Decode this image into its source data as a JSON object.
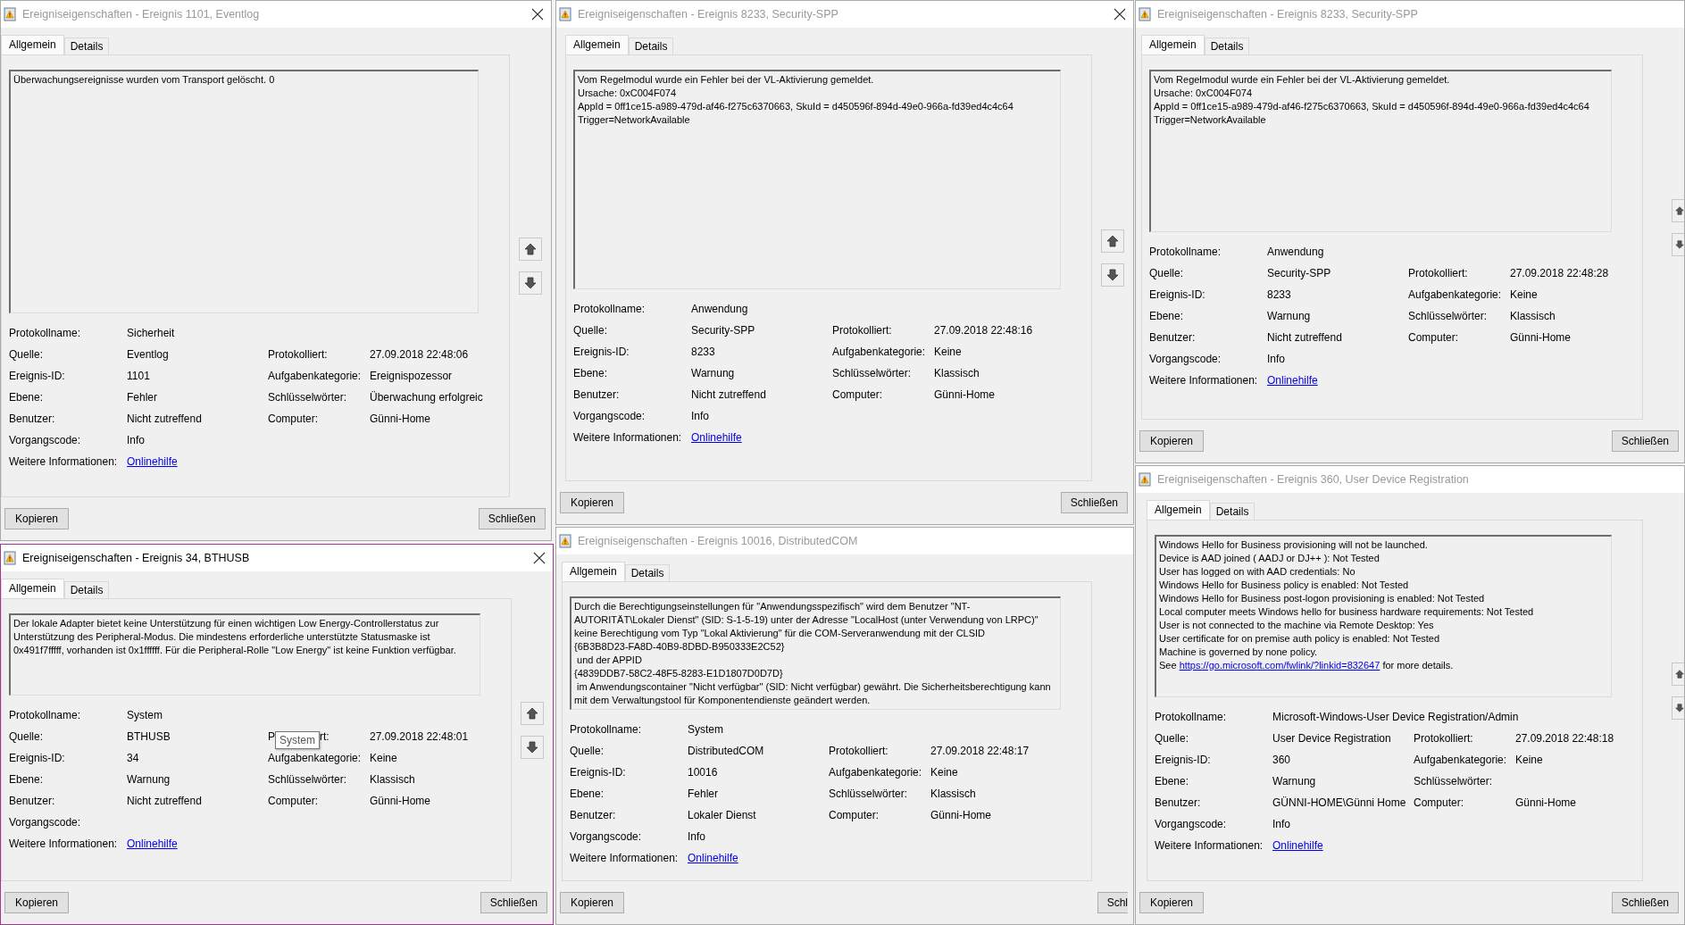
{
  "windows": [
    {
      "title": "Ereigniseigenschaften - Ereignis 1101, Eventlog",
      "active": false,
      "close_button": true,
      "nav_buttons": true,
      "tabs": [
        {
          "label": "Allgemein",
          "selected": true
        },
        {
          "label": "Details",
          "selected": false
        }
      ],
      "message": "Überwachungsereignisse wurden vom Transport gelöscht. 0",
      "fields": [
        {
          "cells": [
            {
              "label": "Protokollname:",
              "value": "Sicherheit"
            }
          ]
        },
        {
          "cells": [
            {
              "label": "Quelle:",
              "value": "Eventlog"
            },
            {
              "label": "Protokolliert:",
              "value": "27.09.2018 22:48:06"
            }
          ]
        },
        {
          "cells": [
            {
              "label": "Ereignis-ID:",
              "value": "1101"
            },
            {
              "label": "Aufgabenkategorie:",
              "value": "Ereignispozessor"
            }
          ]
        },
        {
          "cells": [
            {
              "label": "Ebene:",
              "value": "Fehler"
            },
            {
              "label": "Schlüsselwörter:",
              "value": "Überwachung erfolgreic"
            }
          ]
        },
        {
          "cells": [
            {
              "label": "Benutzer:",
              "value": "Nicht zutreffend"
            },
            {
              "label": "Computer:",
              "value": "Günni-Home"
            }
          ]
        },
        {
          "cells": [
            {
              "label": "Vorgangscode:",
              "value": "Info"
            }
          ]
        },
        {
          "cells": [
            {
              "label": "Weitere Informationen:",
              "link": "Onlinehilfe"
            }
          ]
        }
      ],
      "buttons": [
        "Kopieren",
        "Schließen"
      ]
    },
    {
      "title": "Ereigniseigenschaften - Ereignis 8233, Security-SPP",
      "active": false,
      "close_button": true,
      "nav_buttons": true,
      "tabs": [
        {
          "label": "Allgemein",
          "selected": true
        },
        {
          "label": "Details",
          "selected": false
        }
      ],
      "message": "Vom Regelmodul wurde ein Fehler bei der VL-Aktivierung gemeldet.\nUrsache: 0xC004F074\nAppId = 0ff1ce15-a989-479d-af46-f275c6370663, SkuId = d450596f-894d-49e0-966a-fd39ed4c4c64\nTrigger=NetworkAvailable",
      "fields": [
        {
          "cells": [
            {
              "label": "Protokollname:",
              "value": "Anwendung"
            }
          ]
        },
        {
          "cells": [
            {
              "label": "Quelle:",
              "value": "Security-SPP"
            },
            {
              "label": "Protokolliert:",
              "value": "27.09.2018 22:48:16"
            }
          ]
        },
        {
          "cells": [
            {
              "label": "Ereignis-ID:",
              "value": "8233"
            },
            {
              "label": "Aufgabenkategorie:",
              "value": "Keine"
            }
          ]
        },
        {
          "cells": [
            {
              "label": "Ebene:",
              "value": "Warnung"
            },
            {
              "label": "Schlüsselwörter:",
              "value": "Klassisch"
            }
          ]
        },
        {
          "cells": [
            {
              "label": "Benutzer:",
              "value": "Nicht zutreffend"
            },
            {
              "label": "Computer:",
              "value": "Günni-Home"
            }
          ]
        },
        {
          "cells": [
            {
              "label": "Vorgangscode:",
              "value": "Info"
            }
          ]
        },
        {
          "cells": [
            {
              "label": "Weitere Informationen:",
              "link": "Onlinehilfe"
            }
          ]
        }
      ],
      "buttons": [
        "Kopieren",
        "Schließen"
      ]
    },
    {
      "title": "Ereigniseigenschaften - Ereignis 8233, Security-SPP",
      "active": false,
      "close_button": false,
      "nav_buttons": true,
      "tabs": [
        {
          "label": "Allgemein",
          "selected": true
        },
        {
          "label": "Details",
          "selected": false
        }
      ],
      "message": "Vom Regelmodul wurde ein Fehler bei der VL-Aktivierung gemeldet.\nUrsache: 0xC004F074\nAppId = 0ff1ce15-a989-479d-af46-f275c6370663, SkuId = d450596f-894d-49e0-966a-fd39ed4c4c64\nTrigger=NetworkAvailable",
      "fields": [
        {
          "cells": [
            {
              "label": "Protokollname:",
              "value": "Anwendung"
            }
          ]
        },
        {
          "cells": [
            {
              "label": "Quelle:",
              "value": "Security-SPP"
            },
            {
              "label": "Protokolliert:",
              "value": "27.09.2018 22:48:28"
            }
          ]
        },
        {
          "cells": [
            {
              "label": "Ereignis-ID:",
              "value": "8233"
            },
            {
              "label": "Aufgabenkategorie:",
              "value": "Keine"
            }
          ]
        },
        {
          "cells": [
            {
              "label": "Ebene:",
              "value": "Warnung"
            },
            {
              "label": "Schlüsselwörter:",
              "value": "Klassisch"
            }
          ]
        },
        {
          "cells": [
            {
              "label": "Benutzer:",
              "value": "Nicht zutreffend"
            },
            {
              "label": "Computer:",
              "value": "Günni-Home"
            }
          ]
        },
        {
          "cells": [
            {
              "label": "Vorgangscode:",
              "value": "Info"
            }
          ]
        },
        {
          "cells": [
            {
              "label": "Weitere Informationen:",
              "link": "Onlinehilfe"
            }
          ]
        }
      ],
      "buttons": [
        "Kopieren",
        "Schließen"
      ]
    },
    {
      "title": "Ereigniseigenschaften - Ereignis 34, BTHUSB",
      "active": true,
      "close_button": true,
      "nav_buttons": true,
      "tabs": [
        {
          "label": "Allgemein",
          "selected": true
        },
        {
          "label": "Details",
          "selected": false
        }
      ],
      "message": "Der lokale Adapter bietet keine Unterstützung für einen wichtigen Low Energy-Controllerstatus zur Unterstützung des Peripheral-Modus. Die mindestens erforderliche unterstützte Statusmaske ist 0x491f7fffff, vorhanden ist 0x1ffffff. Für die Peripheral-Rolle \"Low Energy\" ist keine Funktion verfügbar.",
      "fields": [
        {
          "cells": [
            {
              "label": "Protokollname:",
              "value": "System"
            }
          ]
        },
        {
          "cells": [
            {
              "label": "Quelle:",
              "value": "BTHUSB"
            },
            {
              "label": "P",
              "tooltip": "System",
              "label_end": "rt:",
              "value": "27.09.2018 22:48:01"
            }
          ]
        },
        {
          "cells": [
            {
              "label": "Ereignis-ID:",
              "value": "34"
            },
            {
              "label": "Aufgabenkategorie:",
              "value": "Keine"
            }
          ]
        },
        {
          "cells": [
            {
              "label": "Ebene:",
              "value": "Warnung"
            },
            {
              "label": "Schlüsselwörter:",
              "value": "Klassisch"
            }
          ]
        },
        {
          "cells": [
            {
              "label": "Benutzer:",
              "value": "Nicht zutreffend"
            },
            {
              "label": "Computer:",
              "value": "Günni-Home"
            }
          ]
        },
        {
          "cells": [
            {
              "label": "Vorgangscode:"
            }
          ]
        },
        {
          "cells": [
            {
              "label": "Weitere Informationen:",
              "link": "Onlinehilfe"
            }
          ]
        }
      ],
      "buttons": [
        "Kopieren",
        "Schließen"
      ]
    },
    {
      "title": "Ereigniseigenschaften - Ereignis 10016, DistributedCOM",
      "active": false,
      "close_button": false,
      "tabs": [
        {
          "label": "Allgemein",
          "selected": true
        },
        {
          "label": "Details",
          "selected": false
        }
      ],
      "message": "Durch die Berechtigungseinstellungen für \"Anwendungsspezifisch\" wird dem Benutzer \"NT-AUTORITÄT\\Lokaler Dienst\" (SID: S-1-5-19) unter der Adresse \"LocalHost (unter Verwendung von LRPC)\" keine Berechtigung vom Typ \"Lokal Aktivierung\" für die COM-Serveranwendung mit der CLSID\n{6B3B8D23-FA8D-40B9-8DBD-B950333E2C52}\n und der APPID\n{4839DDB7-58C2-48F5-8283-E1D1807D0D7D}\n im Anwendungscontainer \"Nicht verfügbar\" (SID: Nicht verfügbar) gewährt. Die Sicherheitsberechtigung kann mit dem Verwaltungstool für Komponentendienste geändert werden.",
      "fields": [
        {
          "cells": [
            {
              "label": "Protokollname:",
              "value": "System"
            }
          ]
        },
        {
          "cells": [
            {
              "label": "Quelle:",
              "value": "DistributedCOM"
            },
            {
              "label": "Protokolliert:",
              "value": "27.09.2018 22:48:17"
            }
          ]
        },
        {
          "cells": [
            {
              "label": "Ereignis-ID:",
              "value": "10016"
            },
            {
              "label": "Aufgabenkategorie:",
              "value": "Keine"
            }
          ]
        },
        {
          "cells": [
            {
              "label": "Ebene:",
              "value": "Fehler"
            },
            {
              "label": "Schlüsselwörter:",
              "value": "Klassisch"
            }
          ]
        },
        {
          "cells": [
            {
              "label": "Benutzer:",
              "value": "Lokaler Dienst"
            },
            {
              "label": "Computer:",
              "value": "Günni-Home"
            }
          ]
        },
        {
          "cells": [
            {
              "label": "Vorgangscode:",
              "value": "Info"
            }
          ]
        },
        {
          "cells": [
            {
              "label": "Weitere Informationen:",
              "link": "Onlinehilfe"
            }
          ]
        }
      ],
      "buttons": [
        "Kopieren",
        "Schl"
      ]
    },
    {
      "title": "Ereigniseigenschaften - Ereignis 360, User Device Registration",
      "active": false,
      "close_button": false,
      "nav_buttons": true,
      "tabs": [
        {
          "label": "Allgemein",
          "selected": true
        },
        {
          "label": "Details",
          "selected": false
        }
      ],
      "message": "Windows Hello for Business provisioning will not be launched.\nDevice is AAD joined ( AADJ or DJ++ ): Not Tested\nUser has logged on with AAD credentials: No\nWindows Hello for Business policy is enabled: Not Tested\nWindows Hello for Business post-logon provisioning is enabled: Not Tested\nLocal computer meets Windows hello for business hardware requirements: Not Tested\nUser is not connected to the machine via Remote Desktop: Yes\nUser certificate for on premise auth policy is enabled: Not Tested\nMachine is governed by none policy.\nSee ",
      "message_link": "https://go.microsoft.com/fwlink/?linkid=832647",
      "message_end": " for more details.",
      "fields": [
        {
          "cells": [
            {
              "label": "Protokollname:",
              "value": "Microsoft-Windows-User Device Registration/Admin"
            }
          ]
        },
        {
          "cells": [
            {
              "label": "Quelle:",
              "value": "User Device Registration"
            },
            {
              "label": "Protokolliert:",
              "value": "27.09.2018 22:48:18"
            }
          ]
        },
        {
          "cells": [
            {
              "label": "Ereignis-ID:",
              "value": "360"
            },
            {
              "label": "Aufgabenkategorie:",
              "value": "Keine"
            }
          ]
        },
        {
          "cells": [
            {
              "label": "Ebene:",
              "value": "Warnung"
            },
            {
              "label": "Schlüsselwörter:"
            }
          ]
        },
        {
          "cells": [
            {
              "label": "Benutzer:",
              "value": "GÜNNI-HOME\\Günni Home"
            },
            {
              "label": "Computer:",
              "value": "Günni-Home"
            }
          ]
        },
        {
          "cells": [
            {
              "label": "Vorgangscode:",
              "value": "Info"
            }
          ]
        },
        {
          "cells": [
            {
              "label": "Weitere Informationen:",
              "link": "Onlinehilfe"
            }
          ]
        }
      ],
      "buttons": [
        "Kopieren",
        "Schließen"
      ]
    }
  ]
}
